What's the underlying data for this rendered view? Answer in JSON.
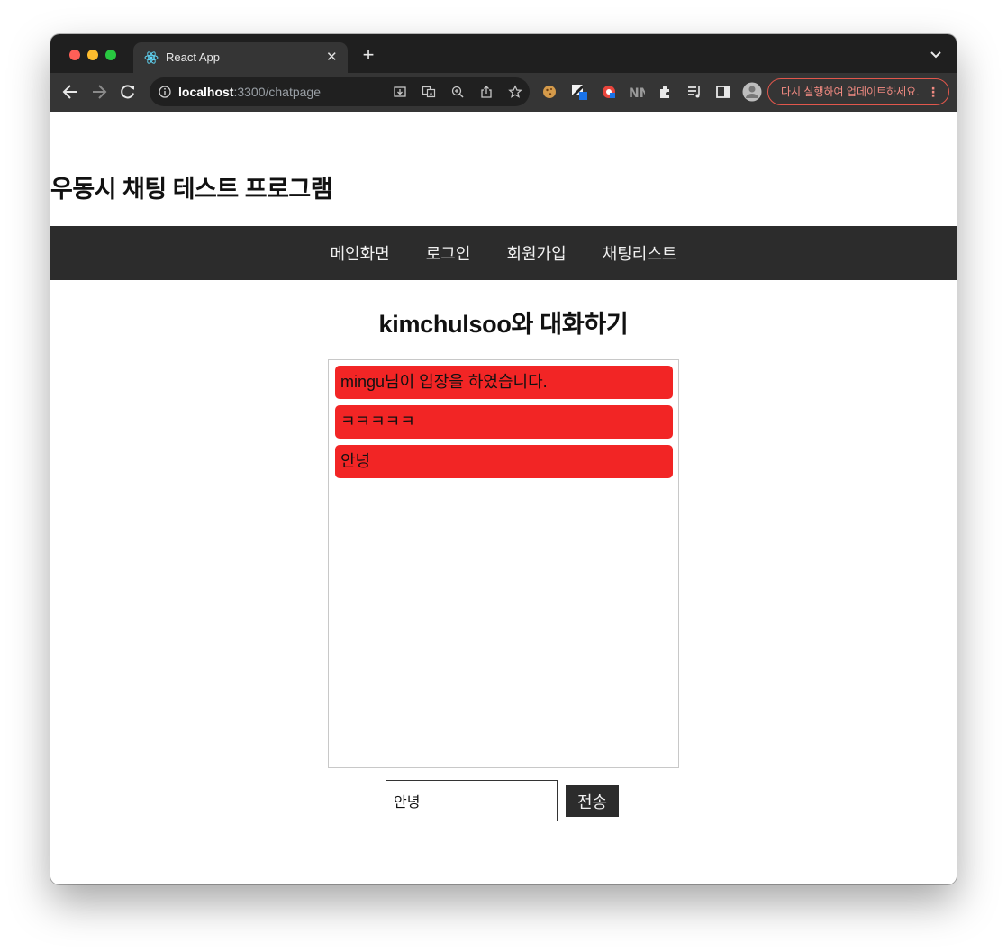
{
  "browser": {
    "tab": {
      "title": "React App",
      "favicon": "react-icon"
    },
    "address_bar": {
      "host": "localhost",
      "rest": ":3300/chatpage"
    },
    "update_button": {
      "label": "다시 실행하여 업데이트하세요.",
      "menu": "⋮"
    },
    "icons": {
      "new_tab": "+",
      "close": "✕"
    }
  },
  "site": {
    "title": "우동시 채팅 테스트 프로그램",
    "nav": [
      {
        "label": "메인화면"
      },
      {
        "label": "로그인"
      },
      {
        "label": "회원가입"
      },
      {
        "label": "채팅리스트"
      }
    ]
  },
  "chat": {
    "heading": "kimchulsoo와 대화하기",
    "messages": [
      {
        "text": "mingu님이 입장을 하였습니다."
      },
      {
        "text": "ㅋㅋㅋㅋㅋ"
      },
      {
        "text": "안녕"
      }
    ],
    "input_value": "안녕",
    "send_label": "전송"
  },
  "colors": {
    "message_bg": "#f22525",
    "navbar_bg": "#2c2c2c",
    "update_accent": "#e2574c"
  }
}
